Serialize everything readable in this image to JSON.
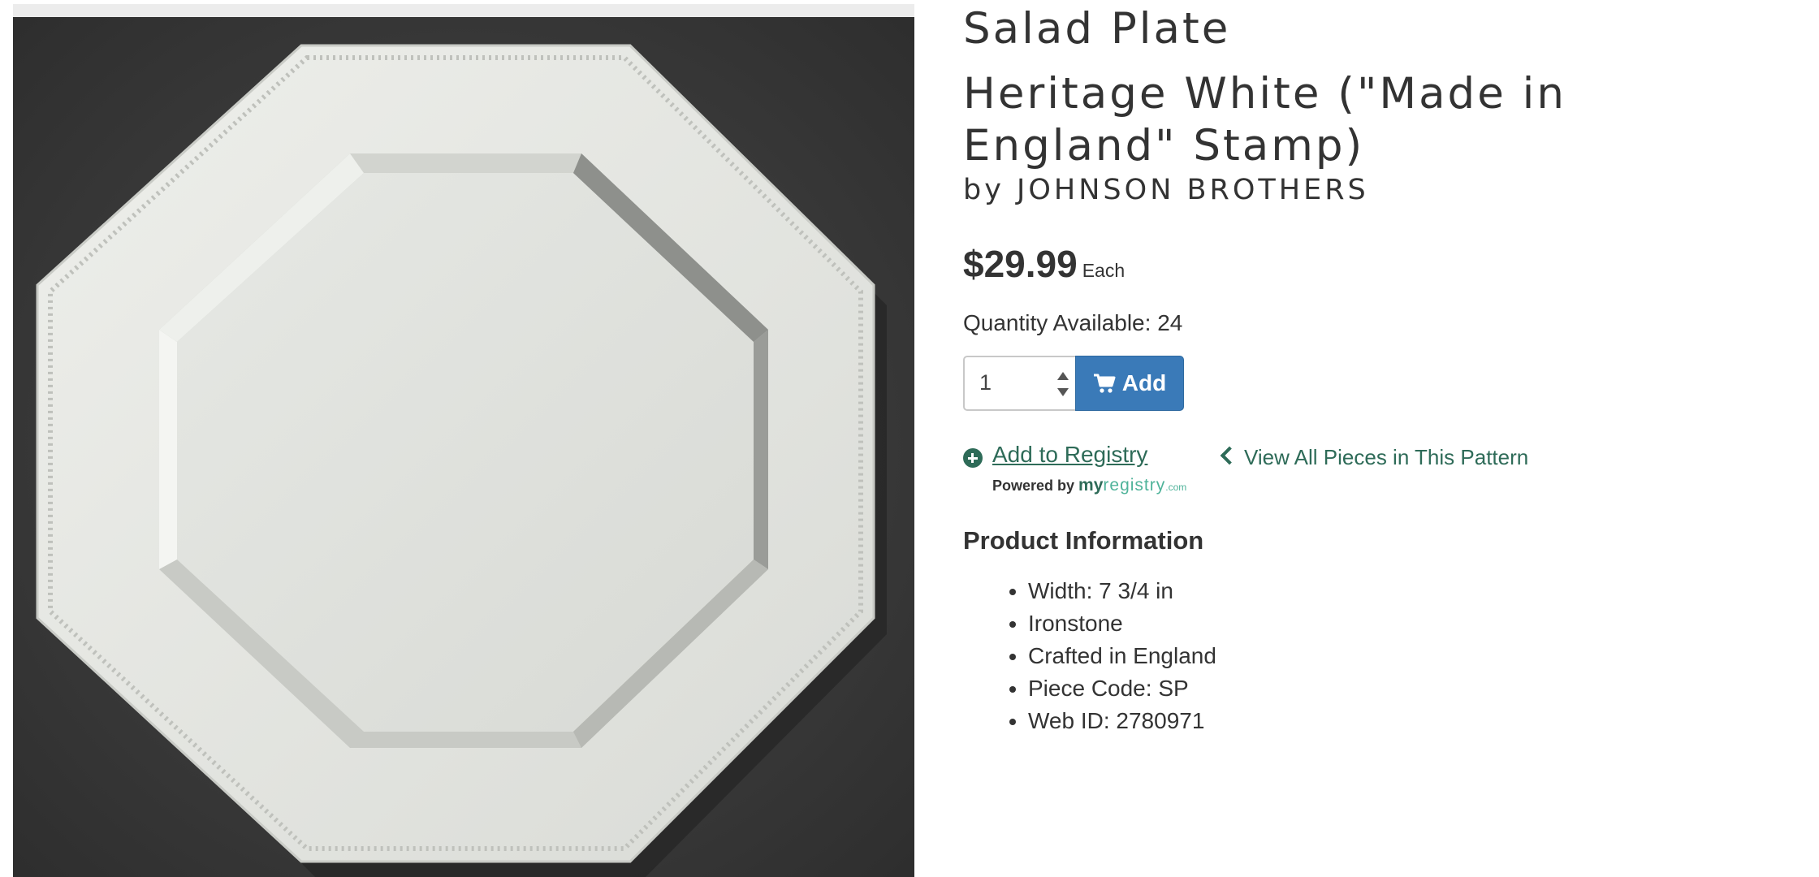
{
  "product": {
    "name": "Salad Plate",
    "pattern": "Heritage White (\"Made in England\" Stamp)",
    "byline": "by JOHNSON BROTHERS",
    "image_alt": "octagonal white salad plate"
  },
  "pricing": {
    "price": "$29.99",
    "unit": "Each",
    "quantity_available": "Quantity Available: 24"
  },
  "cart": {
    "quantity_value": "1",
    "add_label": "Add",
    "button_color": "#3a7ab8"
  },
  "registry": {
    "link_label": "Add to Registry",
    "powered_by": "Powered by",
    "brand_my": "my",
    "brand_registry": "registry",
    "brand_com": ".com"
  },
  "navigation": {
    "view_all_label": "View All Pieces in This Pattern"
  },
  "product_info": {
    "heading": "Product Information",
    "items": [
      "Width: 7 3/4 in",
      "Ironstone",
      "Crafted in England",
      "Piece Code: SP",
      "Web ID: 2780971"
    ]
  },
  "colors": {
    "link_green": "#2e6b58",
    "registry_teal": "#4fb39a",
    "text": "#333333"
  }
}
